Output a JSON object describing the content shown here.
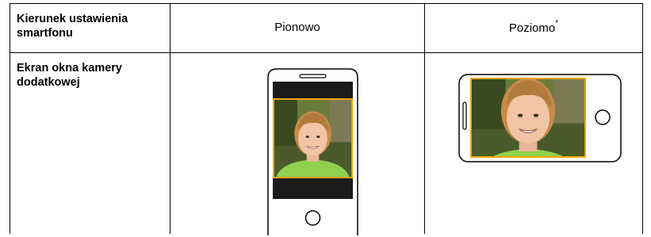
{
  "table": {
    "header_row_label": "Kierunek ustawienia smartfonu",
    "col_portrait": "Pionowo",
    "col_landscape": "Poziomo",
    "col_landscape_footnote_mark": "*",
    "screen_row_label": "Ekran okna kamery dodatkowej"
  },
  "colors": {
    "frame_border": "#f0a500",
    "letterbox": "#1a1a1a",
    "phone_outline": "#000000"
  },
  "icons": {
    "home_button": "circle-home-button-icon",
    "speaker": "speaker-slot-icon"
  }
}
